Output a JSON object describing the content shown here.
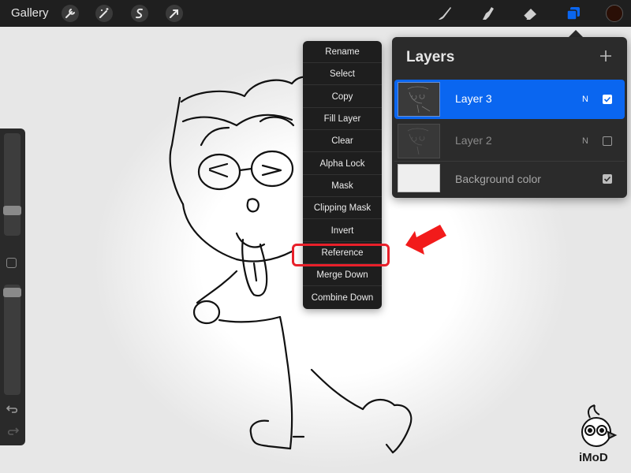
{
  "topbar": {
    "gallery_label": "Gallery",
    "left_tools": [
      "wrench-icon",
      "magic-wand-icon",
      "selection-icon",
      "transform-arrow-icon"
    ],
    "right_tools": [
      "brush-icon",
      "smudge-icon",
      "eraser-icon",
      "layers-icon"
    ],
    "active_tool": "layers-icon",
    "current_color": "#2a0f06"
  },
  "sidebar": {
    "brush_size_level": 0.34,
    "opacity_level": 0.08,
    "undo_icon": "undo-icon",
    "redo_icon": "redo-icon"
  },
  "context_menu": {
    "items": [
      "Rename",
      "Select",
      "Copy",
      "Fill Layer",
      "Clear",
      "Alpha Lock",
      "Mask",
      "Clipping Mask",
      "Invert",
      "Reference",
      "Merge Down",
      "Combine Down"
    ],
    "highlighted_item": "Reference"
  },
  "layers_panel": {
    "title": "Layers",
    "add_icon": "plus-icon",
    "layers": [
      {
        "name": "Layer 3",
        "blend": "N",
        "visible": true,
        "active": true
      },
      {
        "name": "Layer 2",
        "blend": "N",
        "visible": false,
        "active": false
      },
      {
        "name": "Background color",
        "blend": "",
        "visible": true,
        "active": false
      }
    ]
  },
  "colors": {
    "accent": "#0a66f0",
    "highlight": "#e8202a",
    "panel": "#2b2b2b",
    "toolbar": "#1f1f1f"
  },
  "watermark": {
    "text": "iMoD"
  }
}
